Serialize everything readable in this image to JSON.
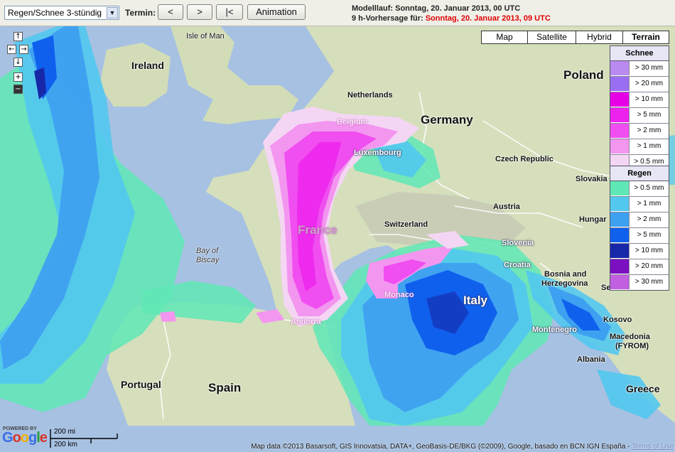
{
  "toolbar": {
    "product_select": "Regen/Schnee 3-stündig",
    "termin_label": "Termin:",
    "prev_label": "<",
    "next_label": ">",
    "first_label": "|<",
    "animation_label": "Animation"
  },
  "run_info": {
    "model_run": "Modelllauf: Sonntag, 20. Januar 2013, 00 UTC",
    "forecast_prefix": "9 h-Vorhersage für:",
    "forecast_date": "Sonntag, 20. Januar 2013, 09 UTC",
    "forecast_color": "#e00000"
  },
  "map_types": [
    "Map",
    "Satellite",
    "Hybrid",
    "Terrain"
  ],
  "map_type_selected": "Terrain",
  "nav_controls": {
    "up": "↑",
    "left": "←",
    "right": "→",
    "down": "↓",
    "zoom_in": "+",
    "zoom_out": "−"
  },
  "legend": {
    "snow_title": "Schnee",
    "snow": [
      {
        "label": "> 30 mm",
        "color": "#b98af0"
      },
      {
        "label": "> 20 mm",
        "color": "#9a6ef2"
      },
      {
        "label": "> 10 mm",
        "color": "#e600e6"
      },
      {
        "label": "> 5 mm",
        "color": "#ee22ee"
      },
      {
        "label": "> 2 mm",
        "color": "#f04ef0"
      },
      {
        "label": "> 1 mm",
        "color": "#f396f0"
      },
      {
        "label": "> 0.5 mm",
        "color": "#f4d6f4"
      }
    ],
    "rain_title": "Regen",
    "rain": [
      {
        "label": "> 0.5 mm",
        "color": "#5fe8b5"
      },
      {
        "label": "> 1 mm",
        "color": "#52c8ef"
      },
      {
        "label": "> 2 mm",
        "color": "#3ea0f0"
      },
      {
        "label": "> 5 mm",
        "color": "#1060ee"
      },
      {
        "label": "> 10 mm",
        "color": "#1628a8"
      },
      {
        "label": "> 20 mm",
        "color": "#7a10c0"
      },
      {
        "label": "> 30 mm",
        "color": "#c060e0"
      }
    ]
  },
  "map_labels": {
    "isle_of_man": "Isle of Man",
    "ireland": "Ireland",
    "netherlands": "Netherlands",
    "germany": "Germany",
    "poland": "Poland",
    "belgium": "Belgium",
    "luxembourg": "Luxembourg",
    "czech_republic": "Czech Republic",
    "slovakia": "Slovakia",
    "austria": "Austria",
    "hungary": "Hungar",
    "france": "France",
    "switzerland": "Switzerland",
    "slovenia": "Slovenia",
    "croatia": "Croatia",
    "bay_of_biscay_1": "Bay of",
    "bay_of_biscay_2": "Biscay",
    "monaco": "Monaco",
    "italy": "Italy",
    "bosnia_1": "Bosnia and",
    "bosnia_2": "Herzegovina",
    "serbia": "Serbia",
    "andorra": "Andorra",
    "montenegro": "Montenegro",
    "kosovo": "Kosovo",
    "macedonia_1": "Macedonia",
    "macedonia_2": "(FYROM)",
    "portugal": "Portugal",
    "spain": "Spain",
    "albania": "Albania",
    "greece": "Greece"
  },
  "footer": {
    "powered_by": "POWERED BY",
    "google": "Google",
    "scale_mi": "200 mi",
    "scale_km": "200 km",
    "attribution": "Map data ©2013 Basarsoft, GIS Innovatsia, DATA+, GeoBasis-DE/BKG (©2009), Google, basado en BCN IGN España -",
    "terms": "Terms of Use"
  }
}
